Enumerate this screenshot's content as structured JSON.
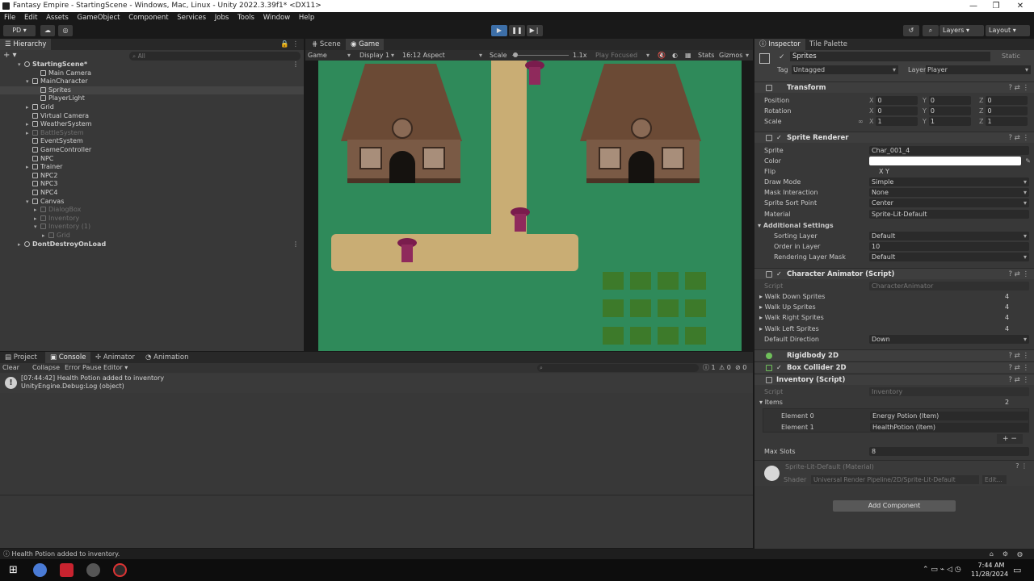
{
  "window": {
    "title": "Fantasy Empire - StartingScene - Windows, Mac, Linux - Unity 2022.3.39f1* <DX11>"
  },
  "menu": [
    "File",
    "Edit",
    "Assets",
    "GameObject",
    "Component",
    "Services",
    "Jobs",
    "Tools",
    "Window",
    "Help"
  ],
  "toolbar": {
    "account": "PD",
    "layers": "Layers",
    "layout": "Layout"
  },
  "hierarchy": {
    "tab": "Hierarchy",
    "search_placeholder": "All",
    "rows": [
      {
        "label": "StartingScene*",
        "indent": 0,
        "arrow": "▾",
        "icon": "unity",
        "dim": false
      },
      {
        "label": "Main Camera",
        "indent": 2,
        "arrow": "",
        "dim": false
      },
      {
        "label": "MainCharacter",
        "indent": 1,
        "arrow": "▾",
        "dim": false
      },
      {
        "label": "Sprites",
        "indent": 2,
        "arrow": "",
        "dim": false,
        "sel": true
      },
      {
        "label": "PlayerLight",
        "indent": 2,
        "arrow": "",
        "dim": false
      },
      {
        "label": "Grid",
        "indent": 1,
        "arrow": "▸",
        "dim": false
      },
      {
        "label": "Virtual Camera",
        "indent": 1,
        "arrow": "",
        "dim": false
      },
      {
        "label": "WeatherSystem",
        "indent": 1,
        "arrow": "▸",
        "dim": false
      },
      {
        "label": "BattleSystem",
        "indent": 1,
        "arrow": "▸",
        "dim": true
      },
      {
        "label": "EventSystem",
        "indent": 1,
        "arrow": "",
        "dim": false
      },
      {
        "label": "GameController",
        "indent": 1,
        "arrow": "",
        "dim": false
      },
      {
        "label": "NPC",
        "indent": 1,
        "arrow": "",
        "dim": false
      },
      {
        "label": "Trainer",
        "indent": 1,
        "arrow": "▸",
        "dim": false
      },
      {
        "label": "NPC2",
        "indent": 1,
        "arrow": "",
        "dim": false
      },
      {
        "label": "NPC3",
        "indent": 1,
        "arrow": "",
        "dim": false
      },
      {
        "label": "NPC4",
        "indent": 1,
        "arrow": "",
        "dim": false
      },
      {
        "label": "Canvas",
        "indent": 1,
        "arrow": "▾",
        "dim": false
      },
      {
        "label": "DialogBox",
        "indent": 2,
        "arrow": "▸",
        "dim": true
      },
      {
        "label": "Inventory",
        "indent": 2,
        "arrow": "▸",
        "dim": true
      },
      {
        "label": "Inventory (1)",
        "indent": 2,
        "arrow": "▾",
        "dim": true
      },
      {
        "label": "Grid",
        "indent": 3,
        "arrow": "▸",
        "dim": true
      },
      {
        "label": "DontDestroyOnLoad",
        "indent": 0,
        "arrow": "▸",
        "icon": "unity",
        "dim": false
      }
    ]
  },
  "game_view": {
    "tabs": [
      "Scene",
      "Game"
    ],
    "mode": "Game",
    "display": "Display 1",
    "aspect": "16:12 Aspect",
    "scale_label": "Scale",
    "scale_value": "1.1x",
    "play_focused": "Play Focused",
    "stats": "Stats",
    "gizmos": "Gizmos"
  },
  "console": {
    "tabs": [
      "Project",
      "Console",
      "Animator",
      "Animation"
    ],
    "buttons": [
      "Clear",
      "Collapse",
      "Error Pause",
      "Editor"
    ],
    "counts": [
      "1",
      "0",
      "0"
    ],
    "entry_line1": "[07:44:42] Health Potion added to inventory",
    "entry_line2": "UnityEngine.Debug:Log (object)"
  },
  "status_bar": "Health Potion added to inventory.",
  "inspector": {
    "tabs": [
      "Inspector",
      "Tile Palette"
    ],
    "object_name": "Sprites",
    "static": "Static",
    "tag_label": "Tag",
    "tag": "Untagged",
    "layer_label": "Layer",
    "layer": "Player",
    "transform": {
      "title": "Transform",
      "position_label": "Position",
      "position": [
        "0",
        "0",
        "0"
      ],
      "rotation_label": "Rotation",
      "rotation": [
        "0",
        "0",
        "0"
      ],
      "scale_label": "Scale",
      "scale": [
        "1",
        "1",
        "1"
      ]
    },
    "sprite_renderer": {
      "title": "Sprite Renderer",
      "rows": [
        {
          "label": "Sprite",
          "value": "Char_001_4"
        },
        {
          "label": "Color",
          "value": ""
        },
        {
          "label": "Flip",
          "value": "X   Y"
        },
        {
          "label": "Draw Mode",
          "value": "Simple"
        },
        {
          "label": "Mask Interaction",
          "value": "None"
        },
        {
          "label": "Sprite Sort Point",
          "value": "Center"
        },
        {
          "label": "Material",
          "value": "Sprite-Lit-Default"
        }
      ],
      "additional": "Additional Settings",
      "sorting_layer_label": "Sorting Layer",
      "sorting_layer": "Default",
      "order_label": "Order in Layer",
      "order": "10",
      "rendering_mask_label": "Rendering Layer Mask",
      "rendering_mask": "Default"
    },
    "character_animator": {
      "title": "Character Animator (Script)",
      "script_label": "Script",
      "script": "CharacterAnimator",
      "rows": [
        {
          "label": "Walk Down Sprites",
          "value": "4"
        },
        {
          "label": "Walk Up Sprites",
          "value": "4"
        },
        {
          "label": "Walk Right Sprites",
          "value": "4"
        },
        {
          "label": "Walk Left Sprites",
          "value": "4"
        }
      ],
      "default_dir_label": "Default Direction",
      "default_dir": "Down"
    },
    "rigidbody": "Rigidbody 2D",
    "box_collider": "Box Collider 2D",
    "inventory": {
      "title": "Inventory (Script)",
      "script_label": "Script",
      "script": "Inventory",
      "items_label": "Items",
      "items_count": "2",
      "elements": [
        {
          "label": "Element 0",
          "value": "Energy Potion (Item)"
        },
        {
          "label": "Element 1",
          "value": "HealthPotion (Item)"
        }
      ],
      "max_slots_label": "Max Slots",
      "max_slots": "8"
    },
    "material": {
      "name": "Sprite-Lit-Default (Material)",
      "shader_label": "Shader",
      "shader": "Universal Render Pipeline/2D/Sprite-Lit-Default",
      "edit": "Edit..."
    },
    "add_component": "Add Component"
  },
  "clock": {
    "time": "7:44 AM",
    "date": "11/28/2024"
  }
}
